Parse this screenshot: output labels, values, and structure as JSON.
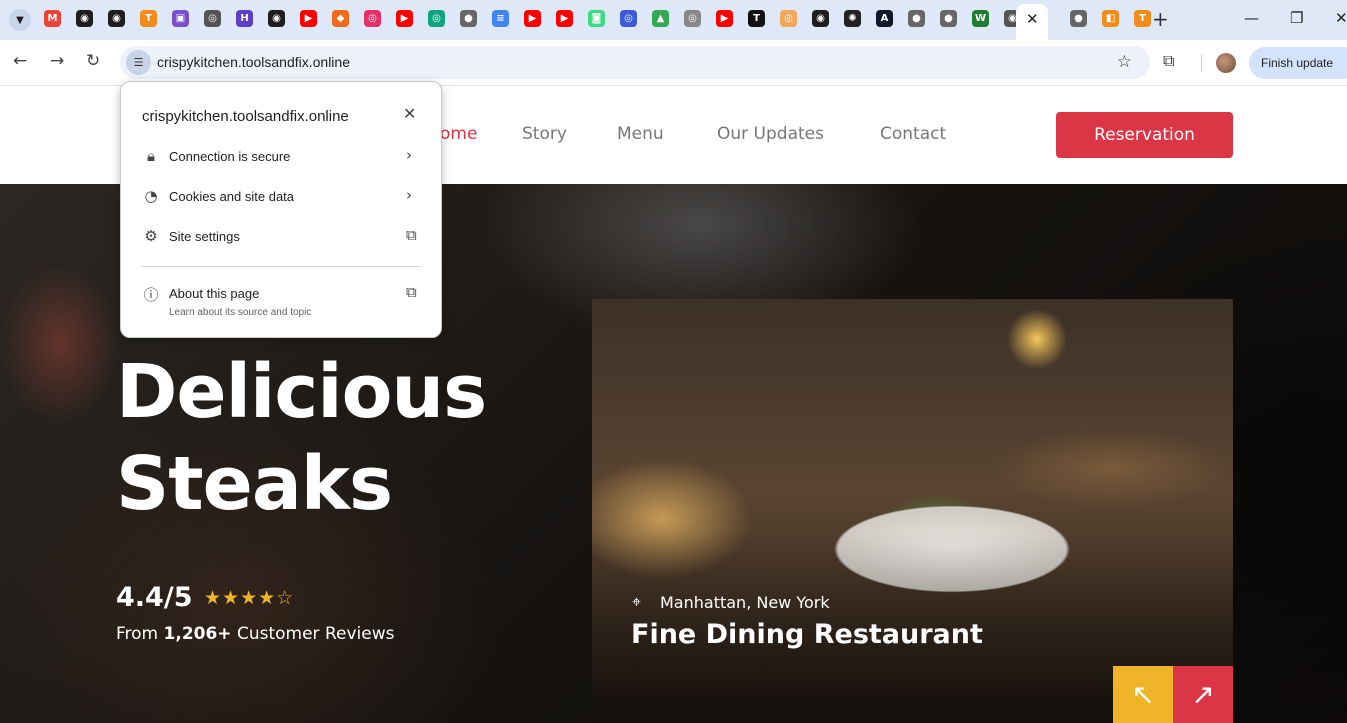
{
  "browser": {
    "tab_icons": [
      {
        "name": "gmail-icon",
        "color": "#ea4335",
        "glyph": "M"
      },
      {
        "name": "github-icon",
        "color": "#1f1f1f",
        "glyph": "◉"
      },
      {
        "name": "github-icon",
        "color": "#1f1f1f",
        "glyph": "◉"
      },
      {
        "name": "t-logo-icon",
        "color": "#f08c1a",
        "glyph": "T"
      },
      {
        "name": "purple-app-icon",
        "color": "#7b4fc9",
        "glyph": "▣"
      },
      {
        "name": "chatgpt-icon",
        "color": "#555555",
        "glyph": "◎"
      },
      {
        "name": "purple-logo-icon",
        "color": "#5b3fc4",
        "glyph": "H"
      },
      {
        "name": "github-icon",
        "color": "#1f1f1f",
        "glyph": "◉"
      },
      {
        "name": "youtube-icon",
        "color": "#ff0000",
        "glyph": "▶"
      },
      {
        "name": "orange-box-icon",
        "color": "#f26b1d",
        "glyph": "◆"
      },
      {
        "name": "pink-app-icon",
        "color": "#e6306b",
        "glyph": "◎"
      },
      {
        "name": "youtube-icon",
        "color": "#ff0000",
        "glyph": "▶"
      },
      {
        "name": "chatgpt-icon",
        "color": "#10a37f",
        "glyph": "◎"
      },
      {
        "name": "globe-icon",
        "color": "#666666",
        "glyph": "●"
      },
      {
        "name": "docs-icon",
        "color": "#4285f4",
        "glyph": "≡"
      },
      {
        "name": "youtube-icon",
        "color": "#ff0000",
        "glyph": "▶"
      },
      {
        "name": "youtube-icon",
        "color": "#ff0000",
        "glyph": "▶"
      },
      {
        "name": "android-icon",
        "color": "#3ddc84",
        "glyph": "◙"
      },
      {
        "name": "circle-app-icon",
        "color": "#3b5bdb",
        "glyph": "◎"
      },
      {
        "name": "drive-icon",
        "color": "#34a853",
        "glyph": "▲"
      },
      {
        "name": "search-app-icon",
        "color": "#888888",
        "glyph": "◎"
      },
      {
        "name": "youtube-icon",
        "color": "#ff0000",
        "glyph": "▶"
      },
      {
        "name": "tw-logo-icon",
        "color": "#111111",
        "glyph": "T"
      },
      {
        "name": "shell-icon",
        "color": "#f2a65a",
        "glyph": "◎"
      },
      {
        "name": "github-icon",
        "color": "#1f1f1f",
        "glyph": "◉"
      },
      {
        "name": "openai-icon",
        "color": "#222222",
        "glyph": "✺"
      },
      {
        "name": "dark-logo-icon",
        "color": "#0f172a",
        "glyph": "A"
      },
      {
        "name": "globe-icon",
        "color": "#666666",
        "glyph": "●"
      },
      {
        "name": "globe-icon",
        "color": "#666666",
        "glyph": "●"
      },
      {
        "name": "w-logo-icon",
        "color": "#1e7d32",
        "glyph": "W"
      },
      {
        "name": "chrome-icon",
        "color": "#555555",
        "glyph": "◉"
      },
      {
        "name": "globe-icon",
        "color": "#666666",
        "glyph": "●"
      },
      {
        "name": "orange-app-icon",
        "color": "#f08c1a",
        "glyph": "◧"
      },
      {
        "name": "t-logo-icon",
        "color": "#f08c1a",
        "glyph": "T"
      }
    ],
    "active_tab_close": "✕",
    "new_tab": "+",
    "url": "crispykitchen.toolsandfix.online",
    "finish_update": "Finish update"
  },
  "site": {
    "nav": [
      "ome",
      "Story",
      "Menu",
      "Our Updates",
      "Contact"
    ],
    "reservation": "Reservation",
    "hero_title_line1": "Delicious",
    "hero_title_line2": "Steaks",
    "rating": "4.4/5",
    "rating_stars": "★★★★☆",
    "rating_stars_value": 4,
    "review_prefix": "From ",
    "review_count": "1,206+",
    "review_suffix": " Customer Reviews",
    "location": "Manhattan, New York",
    "photo_title": "Fine Dining Restaurant",
    "prev_arrow": "↖",
    "next_arrow": "↗"
  },
  "popup": {
    "title": "crispykitchen.toolsandfix.online",
    "rows": [
      {
        "label": "Connection is secure",
        "icon": "lock-icon"
      },
      {
        "label": "Cookies and site data",
        "icon": "cookie-icon"
      },
      {
        "label": "Site settings",
        "icon": "gear-icon"
      },
      {
        "label": "About this page",
        "icon": "info-icon"
      }
    ],
    "about_sub": "Learn about its source and topic"
  }
}
